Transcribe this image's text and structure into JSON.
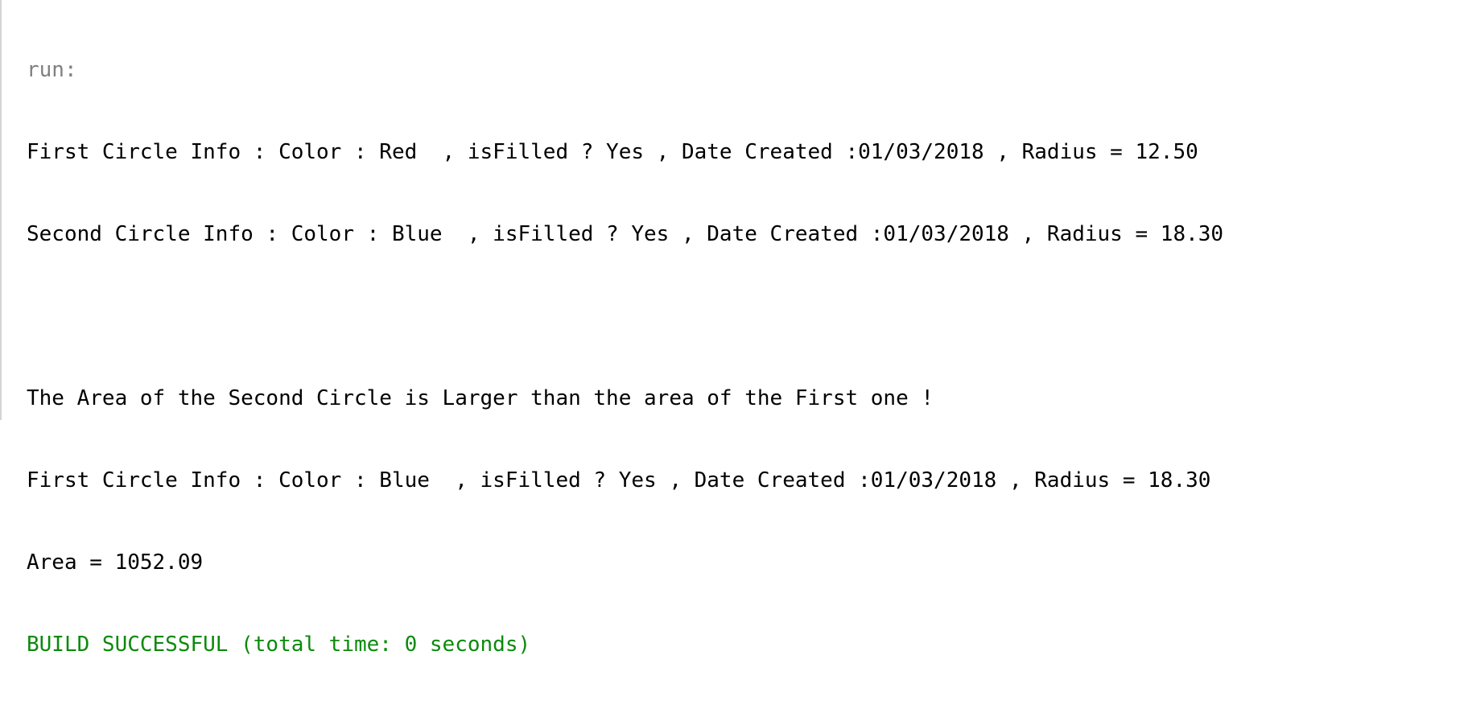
{
  "console": {
    "run_label": "run:",
    "lines": [
      "First Circle Info : Color : Red  , isFilled ? Yes , Date Created :01/03/2018 , Radius = 12.50",
      "Second Circle Info : Color : Blue  , isFilled ? Yes , Date Created :01/03/2018 , Radius = 18.30",
      "",
      "The Area of the Second Circle is Larger than the area of the First one !",
      "First Circle Info : Color : Blue  , isFilled ? Yes , Date Created :01/03/2018 , Radius = 18.30",
      "Area = 1052.09"
    ],
    "build_status": "BUILD SUCCESSFUL (total time: 0 seconds)"
  },
  "colors": {
    "run_label": "#808080",
    "text": "#000000",
    "success": "#0b8a0b",
    "background": "#ffffff"
  }
}
